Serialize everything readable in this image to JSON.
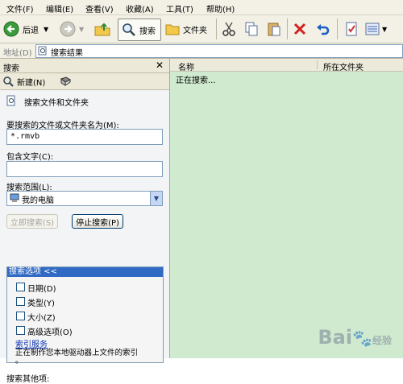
{
  "menu": {
    "items": [
      "文件(F)",
      "编辑(E)",
      "查看(V)",
      "收藏(A)",
      "工具(T)",
      "帮助(H)"
    ]
  },
  "toolbar": {
    "back_label": "后退",
    "search_label": "搜索",
    "folders_label": "文件夹"
  },
  "address": {
    "label": "地址(D)",
    "value": "搜索结果"
  },
  "left_pane": {
    "title": "搜索",
    "new_label": "新建(N)",
    "section_title": "搜索文件和文件夹",
    "name_label": "要搜索的文件或文件夹名为(M):",
    "name_value": "*.rmvb",
    "contains_label": "包含文字(C):",
    "contains_value": "",
    "scope_label": "搜索范围(L):",
    "scope_value": "我的电脑",
    "search_now": "立即搜索(S)",
    "stop_search": "停止搜索(P)",
    "options_title": "搜索选项 <<",
    "options": [
      {
        "label": "日期(D)",
        "checked": false
      },
      {
        "label": "类型(Y)",
        "checked": false
      },
      {
        "label": "大小(Z)",
        "checked": false
      },
      {
        "label": "高级选项(O)",
        "checked": false
      }
    ],
    "index_link": "索引服务",
    "index_desc_1": "正在制作您本地驱动器上文件的索引",
    "index_desc_2": "。",
    "other_label": "搜索其他项:"
  },
  "right_pane": {
    "col_name": "名称",
    "col_folder": "所在文件夹",
    "status": "正在搜索..."
  },
  "watermark": {
    "text": "Bai",
    "text2": "经验"
  }
}
